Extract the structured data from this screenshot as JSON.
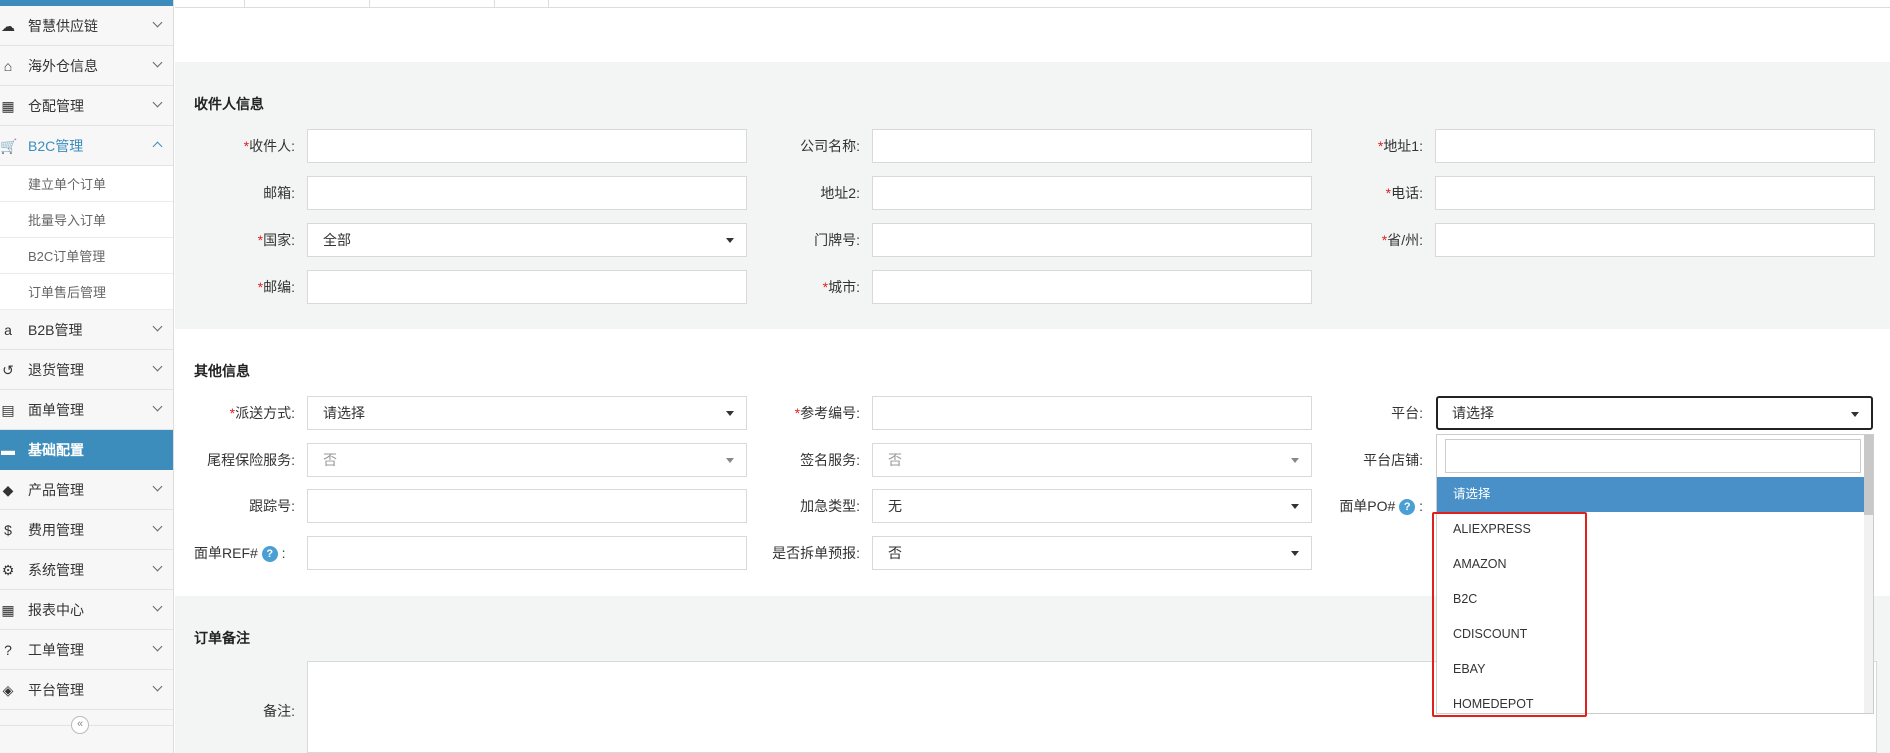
{
  "sidebar": {
    "items": [
      {
        "label": "智慧供应链",
        "icon": "cloud-icon",
        "glyph": "☁"
      },
      {
        "label": "海外仓信息",
        "icon": "home-icon",
        "glyph": "⌂"
      },
      {
        "label": "仓配管理",
        "icon": "grid-icon",
        "glyph": "▦"
      },
      {
        "label": "B2C管理",
        "icon": "cart-icon",
        "glyph": "🛒"
      },
      {
        "label": "B2B管理",
        "icon": "amazon-icon",
        "glyph": "a"
      },
      {
        "label": "退货管理",
        "icon": "undo-icon",
        "glyph": "↺"
      },
      {
        "label": "面单管理",
        "icon": "document-icon",
        "glyph": "▤"
      },
      {
        "label": "基础配置",
        "icon": "folder-icon",
        "glyph": "▬"
      },
      {
        "label": "产品管理",
        "icon": "tag-icon",
        "glyph": "◆"
      },
      {
        "label": "费用管理",
        "icon": "dollar-icon",
        "glyph": "$"
      },
      {
        "label": "系统管理",
        "icon": "gear-icon",
        "glyph": "⚙"
      },
      {
        "label": "报表中心",
        "icon": "table-icon",
        "glyph": "▦"
      },
      {
        "label": "工单管理",
        "icon": "question-icon",
        "glyph": "?"
      },
      {
        "label": "平台管理",
        "icon": "cube-icon",
        "glyph": "◈"
      }
    ],
    "b2c_sub": [
      "建立单个订单",
      "批量导入订单",
      "B2C订单管理",
      "订单售后管理"
    ],
    "collapse_glyph": "«"
  },
  "consignee": {
    "title": "收件人信息",
    "required_mark": "*",
    "fields": {
      "recipient": "收件人:",
      "company": "公司名称:",
      "address1": "地址1:",
      "email": "邮箱:",
      "address2": "地址2:",
      "phone": "电话:",
      "country": "国家:",
      "country_value": "全部",
      "house_no": "门牌号:",
      "province": "省/州:",
      "zipcode": "邮编:",
      "city": "城市:"
    }
  },
  "other": {
    "title": "其他信息",
    "delivery": "派送方式:",
    "delivery_value": "请选择",
    "reference": "参考编号:",
    "platform": "平台:",
    "platform_value": "请选择",
    "insurance": "尾程保险服务:",
    "insurance_value": "否",
    "signature": "签名服务:",
    "signature_value": "否",
    "platform_store": "平台店铺:",
    "tracking": "跟踪号:",
    "urgent": "加急类型:",
    "urgent_value": "无",
    "po": "面单PO#",
    "ref": "面单REF#",
    "split": "是否拆单预报:",
    "split_value": "否",
    "colon": ":",
    "help_glyph": "?"
  },
  "remark": {
    "title": "订单备注",
    "label": "备注:"
  },
  "platform_dropdown": {
    "options": [
      "请选择",
      "ALIEXPRESS",
      "AMAZON",
      "B2C",
      "CDISCOUNT",
      "EBAY",
      "HOMEDEPOT"
    ],
    "highlighted_index": 0
  },
  "colors": {
    "accent": "#3c8dbc",
    "required": "#e02020",
    "highlight_box": "#e0201c"
  }
}
